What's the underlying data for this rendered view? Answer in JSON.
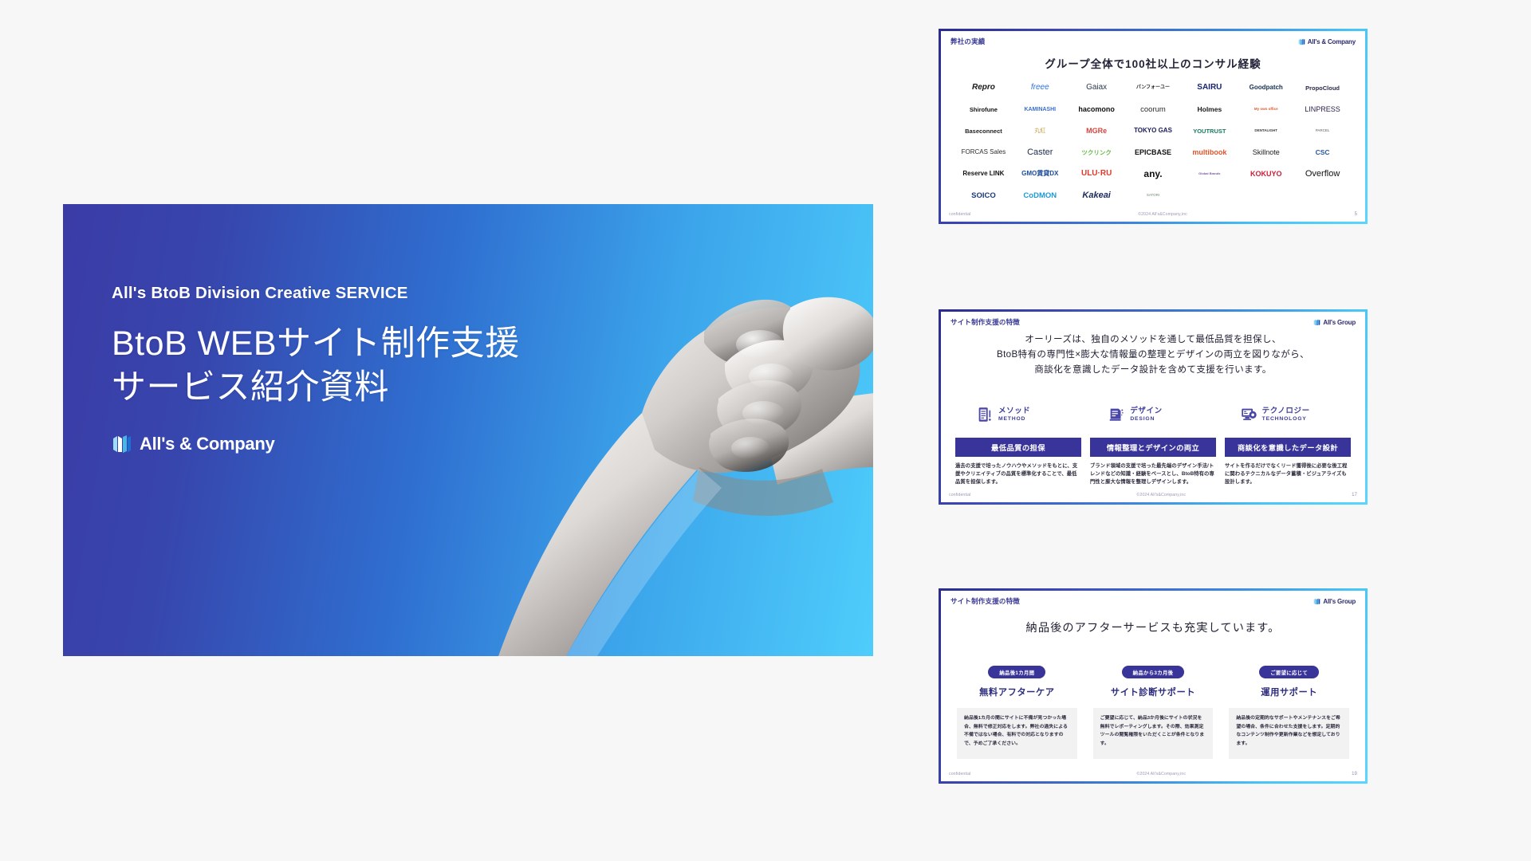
{
  "hero": {
    "eyebrow": "All's BtoB Division Creative SERVICE",
    "title_line1": "BtoB WEBサイト制作支援",
    "title_line2": "サービス紹介資料",
    "logo_text": "All's & Company",
    "gradient_from": "#3b3ba6",
    "gradient_to": "#4ecdfb",
    "photo_alt": "clasped-hands-photo"
  },
  "thumbnails": [
    {
      "id": "slide-5",
      "kicker": "弊社の実績",
      "logo_text": "All's & Company",
      "title": "グループ全体で100社以上のコンサル経験",
      "logos": [
        {
          "name": "Repro",
          "color": "#1a1a1a",
          "weight": "bold",
          "style": "italic",
          "size": 10
        },
        {
          "name": "freee",
          "color": "#2d6fe0",
          "weight": "normal",
          "style": "italic",
          "size": 10
        },
        {
          "name": "Gaiax",
          "color": "#2b3a4a",
          "weight": "normal",
          "style": "normal",
          "size": 10
        },
        {
          "name": "パンフォーユー",
          "color": "#2b2b2b",
          "weight": "bold",
          "style": "normal",
          "size": 6
        },
        {
          "name": "SAIRU",
          "color": "#15246b",
          "weight": "bold",
          "style": "normal",
          "size": 10
        },
        {
          "name": "Goodpatch",
          "color": "#17304f",
          "weight": "bold",
          "style": "normal",
          "size": 8
        },
        {
          "name": "PropoCloud",
          "color": "#2b2b4a",
          "weight": "bold",
          "style": "normal",
          "size": 7.5
        },
        {
          "name": "Shirofune",
          "color": "#111111",
          "weight": "bold",
          "style": "normal",
          "size": 7.5
        },
        {
          "name": "KAMINASHI",
          "color": "#3a6fd0",
          "weight": "bold",
          "style": "normal",
          "size": 7
        },
        {
          "name": "hacomono",
          "color": "#111111",
          "weight": "bold",
          "style": "normal",
          "size": 9
        },
        {
          "name": "coorum",
          "color": "#2b2b2b",
          "weight": "normal",
          "style": "normal",
          "size": 9.5
        },
        {
          "name": "Holmes",
          "color": "#1a1a1a",
          "weight": "bold",
          "style": "normal",
          "size": 8.5
        },
        {
          "name": "My own office",
          "color": "#d8582c",
          "weight": "bold",
          "style": "normal",
          "size": 4.5
        },
        {
          "name": "LINPRESS",
          "color": "#2a1f4a",
          "weight": "normal",
          "style": "normal",
          "size": 9
        },
        {
          "name": "Baseconnect",
          "color": "#222222",
          "weight": "bold",
          "style": "normal",
          "size": 7.5
        },
        {
          "name": "丸紅",
          "color": "#c9a24a",
          "weight": "normal",
          "style": "normal",
          "size": 7
        },
        {
          "name": "MGRe",
          "color": "#d6443c",
          "weight": "bold",
          "style": "normal",
          "size": 9
        },
        {
          "name": "TOKYO GAS",
          "color": "#1b1b5a",
          "weight": "bold",
          "style": "normal",
          "size": 8
        },
        {
          "name": "YOUTRUST",
          "color": "#1a7a63",
          "weight": "bold",
          "style": "normal",
          "size": 7.5
        },
        {
          "name": "DENTALIGHT",
          "color": "#3a3a3a",
          "weight": "bold",
          "style": "normal",
          "size": 4.5
        },
        {
          "name": "PARCEL",
          "color": "#5a5a5a",
          "weight": "normal",
          "style": "normal",
          "size": 4.5
        },
        {
          "name": "FORCAS Sales",
          "color": "#2b2b2b",
          "weight": "normal",
          "style": "normal",
          "size": 8
        },
        {
          "name": "Caster",
          "color": "#1b2a4a",
          "weight": "normal",
          "style": "normal",
          "size": 11
        },
        {
          "name": "ツクリンク",
          "color": "#6ab84a",
          "weight": "bold",
          "style": "normal",
          "size": 7.5
        },
        {
          "name": "EPICBASE",
          "color": "#111111",
          "weight": "bold",
          "style": "normal",
          "size": 9
        },
        {
          "name": "multibook",
          "color": "#e0542a",
          "weight": "bold",
          "style": "normal",
          "size": 9
        },
        {
          "name": "Skillnote",
          "color": "#1d1d1d",
          "weight": "normal",
          "style": "normal",
          "size": 9
        },
        {
          "name": "CSC",
          "color": "#2a5a9a",
          "weight": "bold",
          "style": "normal",
          "size": 8.5
        },
        {
          "name": "Reserve LINK",
          "color": "#111111",
          "weight": "bold",
          "style": "normal",
          "size": 8
        },
        {
          "name": "GMO賃貸DX",
          "color": "#1b4a9a",
          "weight": "bold",
          "style": "normal",
          "size": 8
        },
        {
          "name": "ULU·RU",
          "color": "#e03a2a",
          "weight": "bold",
          "style": "normal",
          "size": 10
        },
        {
          "name": "any.",
          "color": "#111111",
          "weight": "bold",
          "style": "normal",
          "size": 12
        },
        {
          "name": "Global Brands",
          "color": "#7a5aa8",
          "weight": "bold",
          "style": "normal",
          "size": 4
        },
        {
          "name": "KOKUYO",
          "color": "#cf1b3a",
          "weight": "bold",
          "style": "normal",
          "size": 9
        },
        {
          "name": "Overflow",
          "color": "#111111",
          "weight": "normal",
          "style": "normal",
          "size": 11
        },
        {
          "name": "SOICO",
          "color": "#1b3a7a",
          "weight": "bold",
          "style": "normal",
          "size": 9.5
        },
        {
          "name": "CoDMON",
          "color": "#1a9ad6",
          "weight": "bold",
          "style": "normal",
          "size": 9.5
        },
        {
          "name": "Kakeai",
          "color": "#1b2a5a",
          "weight": "bold",
          "style": "italic",
          "size": 11
        },
        {
          "name": "SATORI",
          "color": "#6a8a6a",
          "weight": "normal",
          "style": "normal",
          "size": 4.5
        }
      ],
      "footer": {
        "left": "confidential",
        "center": "©2024 All's&Company,inc",
        "page": "5"
      }
    },
    {
      "id": "slide-17",
      "kicker": "サイト制作支援の特徴",
      "logo_text": "All's Group",
      "lead_lines": [
        "オーリーズは、独自のメソッドを通して最低品質を担保し、",
        "BtoB特有の専門性×膨大な情報量の整理とデザインの両立を図りながら、",
        "商談化を意識したデータ設計を含めて支援を行います。"
      ],
      "pillars": [
        {
          "icon": "clipboard-icon",
          "ja": "メソッド",
          "en": "METHOD"
        },
        {
          "icon": "document-icon",
          "ja": "デザイン",
          "en": "DESIGN"
        },
        {
          "icon": "monitor-gear-icon",
          "ja": "テクノロジー",
          "en": "TECHNOLOGY"
        }
      ],
      "cards": [
        {
          "head": "最低品質の担保",
          "body": "過去の支援で培ったノウハウやメソッドをもとに、支援やクリエイティブの品質を標準化することで、最低品質を担保します。"
        },
        {
          "head": "情報整理とデザインの両立",
          "body": "ブランド領域の支援で培った最先端のデザイン手法/トレンドなどの知識・経験をベースとし、BtoB特有の専門性と膨大な情報を整理しデザインします。"
        },
        {
          "head": "商談化を意識したデータ設計",
          "body": "サイトを作るだけでなくリード獲得後に必要な後工程に関わるテクニカルなデータ蓄積・ビジュアライズも設計します。"
        }
      ],
      "footer": {
        "left": "confidential",
        "center": "©2024 All's&Company,inc",
        "page": "17"
      }
    },
    {
      "id": "slide-19",
      "kicker": "サイト制作支援の特徴",
      "logo_text": "All's Group",
      "lead": "納品後のアフターサービスも充実しています。",
      "columns": [
        {
          "pill": "納品後1カ月間",
          "title": "無料アフターケア",
          "body": "納品後1カ月の間にサイトに不備が見つかった場合、無料で修正対応をします。弊社の過失による不備ではない場合、有料での対応となりますので、予めご了承ください。"
        },
        {
          "pill": "納品から3カ月後",
          "title": "サイト診断サポート",
          "body": "ご要望に応じて、納品3か月後にサイトの状況を無料でレポーティングします。その際、効果測定ツールの閲覧権限をいただくことが条件となります。"
        },
        {
          "pill": "ご要望に応じて",
          "title": "運用サポート",
          "body": "納品後の定期的なサポートやメンテナンスをご希望の場合、条件に合わせた支援をします。定期的なコンテンツ制作や更新作業などを想定しております。"
        }
      ],
      "footer": {
        "left": "confidential",
        "center": "©2024 All's&Company,inc",
        "page": "19"
      }
    }
  ],
  "colors": {
    "brand_indigo": "#393499",
    "brand_cyan": "#4ecdfb",
    "accent_blue": "#2d6fe0",
    "page_bg": "#f7f7f7"
  }
}
